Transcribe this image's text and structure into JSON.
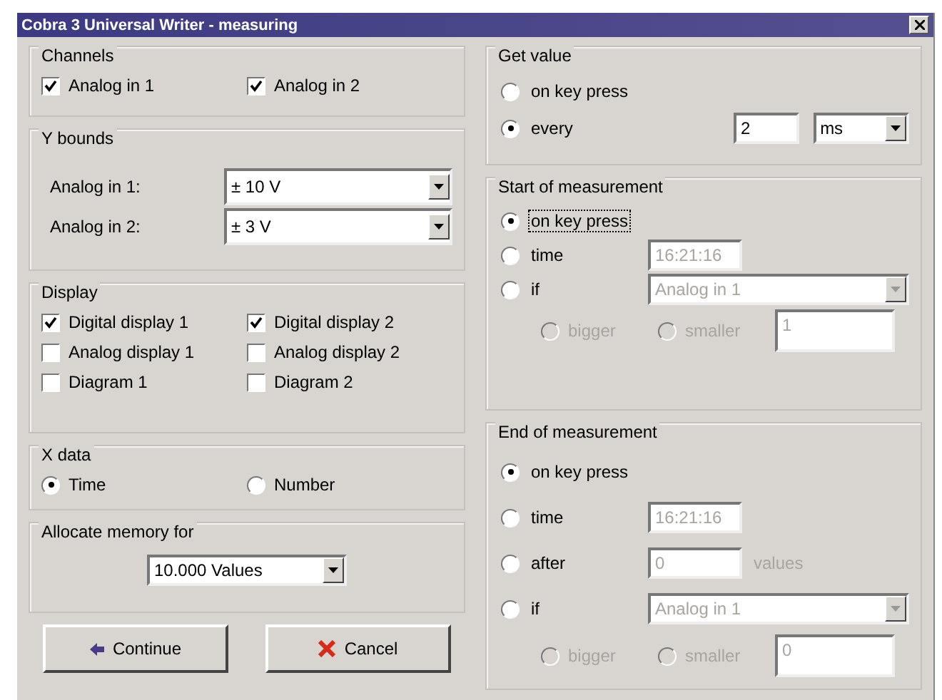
{
  "window": {
    "title": "Cobra 3 Universal Writer - measuring"
  },
  "channels": {
    "title": "Channels",
    "items": [
      {
        "label": "Analog in 1",
        "checked": true
      },
      {
        "label": "Analog in 2",
        "checked": true
      }
    ]
  },
  "y_bounds": {
    "title": "Y bounds",
    "rows": [
      {
        "label": "Analog in 1:",
        "value": "± 10 V"
      },
      {
        "label": "Analog in 2:",
        "value": "± 3 V"
      }
    ]
  },
  "display": {
    "title": "Display",
    "items": [
      {
        "label": "Digital display 1",
        "checked": true
      },
      {
        "label": "Digital display 2",
        "checked": true
      },
      {
        "label": "Analog display 1",
        "checked": false
      },
      {
        "label": "Analog display 2",
        "checked": false
      },
      {
        "label": "Diagram 1",
        "checked": false
      },
      {
        "label": "Diagram 2",
        "checked": false
      }
    ]
  },
  "x_data": {
    "title": "X data",
    "options": [
      {
        "label": "Time",
        "selected": true
      },
      {
        "label": "Number",
        "selected": false
      }
    ]
  },
  "memory": {
    "title": "Allocate memory for",
    "value": "10.000 Values"
  },
  "buttons": [
    {
      "label": "Continue",
      "kind": "continue"
    },
    {
      "label": "Cancel",
      "kind": "cancel"
    }
  ],
  "get_value": {
    "title": "Get value",
    "options": [
      {
        "kind": "plain",
        "label": "on key press",
        "selected": false
      },
      {
        "kind": "field_dropdown",
        "label": "every",
        "selected": true,
        "value": "2",
        "unit": "ms"
      }
    ]
  },
  "start": {
    "title": "Start of measurement",
    "options": [
      {
        "kind": "plain",
        "label": "on key press",
        "selected": true,
        "focused": true
      },
      {
        "kind": "field",
        "label": "time",
        "selected": false,
        "value": "16:21:16",
        "disabled": true
      },
      {
        "kind": "dropdown",
        "label": "if",
        "selected": false,
        "value": "Analog in 1",
        "disabled": true
      }
    ],
    "condition": {
      "options": [
        {
          "label": "bigger",
          "selected": false
        },
        {
          "label": "smaller",
          "selected": false
        }
      ],
      "value": "1",
      "disabled": true
    }
  },
  "end": {
    "title": "End of measurement",
    "options": [
      {
        "kind": "plain",
        "label": "on key press",
        "selected": true,
        "focused": false
      },
      {
        "kind": "field",
        "label": "time",
        "selected": false,
        "value": "16:21:16",
        "disabled": true
      },
      {
        "kind": "field",
        "label": "after",
        "selected": false,
        "value": "0",
        "suffix": "values",
        "disabled": true
      },
      {
        "kind": "dropdown",
        "label": "if",
        "selected": false,
        "value": "Analog in 1",
        "disabled": true
      }
    ],
    "condition": {
      "options": [
        {
          "label": "bigger",
          "selected": false
        },
        {
          "label": "smaller",
          "selected": false
        }
      ],
      "value": "0",
      "disabled": true
    }
  }
}
